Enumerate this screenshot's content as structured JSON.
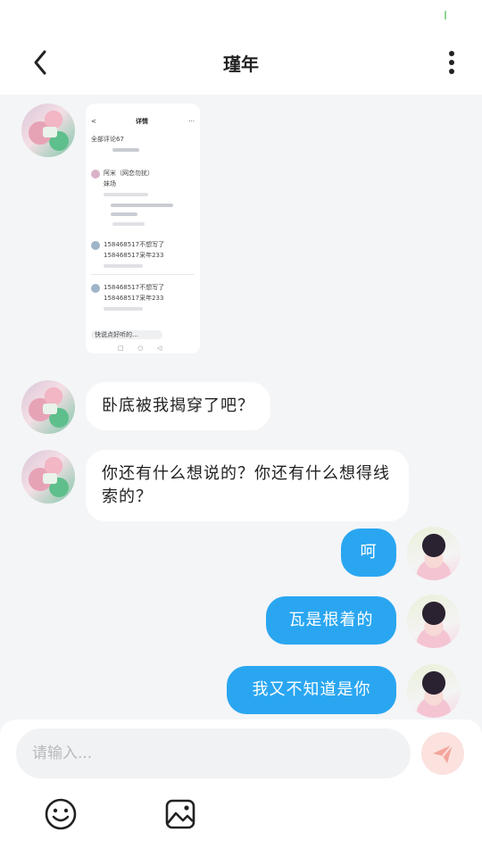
{
  "header": {
    "title": "瑾年"
  },
  "icons": {
    "back": "chevron-left-icon",
    "more": "more-vertical-icon",
    "emoji": "smiley-icon",
    "image": "image-icon",
    "send": "send-icon"
  },
  "colors": {
    "accent": "#2aa6f1",
    "send_button_bg": "#fbe2df",
    "send_arrow": "#f4a69c",
    "page_bg": "#f4f5f7"
  },
  "shared_screenshot": {
    "title": "详情",
    "comment_count": "全部评论67",
    "comments": [
      {
        "name": "阿米（网恋勿扰）",
        "text": "妹场"
      },
      {
        "name": "158468517不想写了",
        "text": "158468517采年233"
      },
      {
        "name": "158468517不想写了",
        "text": "158468517采年233"
      }
    ],
    "input_placeholder": "快说点好听的..."
  },
  "messages": [
    {
      "side": "in",
      "text": "卧底被我揭穿了吧？"
    },
    {
      "side": "in",
      "text": "你还有什么想说的？你还有什么想得线索的？"
    },
    {
      "side": "out",
      "text": "呵"
    },
    {
      "side": "out",
      "text": "瓦是根着的"
    },
    {
      "side": "out",
      "text": "我又不知道是你"
    }
  ],
  "composer": {
    "placeholder": "请输入..."
  }
}
